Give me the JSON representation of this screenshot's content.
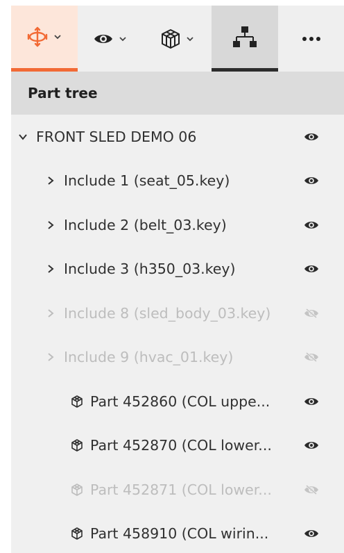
{
  "toolbar": {
    "items": [
      {
        "icon": "explode-icon",
        "has_dropdown": true,
        "active": true,
        "accent": "#f26a35"
      },
      {
        "icon": "eye-icon",
        "has_dropdown": true,
        "active": false
      },
      {
        "icon": "cube-icon",
        "has_dropdown": true,
        "active": false
      },
      {
        "icon": "hierarchy-icon",
        "has_dropdown": false,
        "active": true
      },
      {
        "icon": "more-icon",
        "has_dropdown": false,
        "active": false
      }
    ]
  },
  "panel": {
    "title": "Part tree"
  },
  "tree": {
    "items": [
      {
        "label": "FRONT SLED DEMO 06",
        "level": 0,
        "expander": "expanded",
        "kind": "root",
        "visible": true
      },
      {
        "label": "Include 1 (seat_05.key)",
        "level": 1,
        "expander": "collapsed",
        "kind": "include",
        "visible": true
      },
      {
        "label": "Include 2 (belt_03.key)",
        "level": 1,
        "expander": "collapsed",
        "kind": "include",
        "visible": true
      },
      {
        "label": "Include 3 (h350_03.key)",
        "level": 1,
        "expander": "collapsed",
        "kind": "include",
        "visible": true
      },
      {
        "label": "Include 8 (sled_body_03.key)",
        "level": 1,
        "expander": "collapsed",
        "kind": "include",
        "visible": false
      },
      {
        "label": "Include 9 (hvac_01.key)",
        "level": 1,
        "expander": "collapsed",
        "kind": "include",
        "visible": false
      },
      {
        "label": "Part 452860 (COL uppe...",
        "level": 2,
        "expander": "none",
        "kind": "part",
        "visible": true
      },
      {
        "label": "Part 452870 (COL lower...",
        "level": 2,
        "expander": "none",
        "kind": "part",
        "visible": true
      },
      {
        "label": "Part 452871 (COL lower...",
        "level": 2,
        "expander": "none",
        "kind": "part",
        "visible": false
      },
      {
        "label": "Part 458910 (COL wirin...",
        "level": 2,
        "expander": "none",
        "kind": "part",
        "visible": true
      }
    ]
  },
  "colors": {
    "accent": "#f26a35",
    "text": "#303030",
    "text_hidden": "#bdbdbd",
    "panel_bg": "#f0f0f0",
    "header_bg": "#dcdcdc"
  }
}
